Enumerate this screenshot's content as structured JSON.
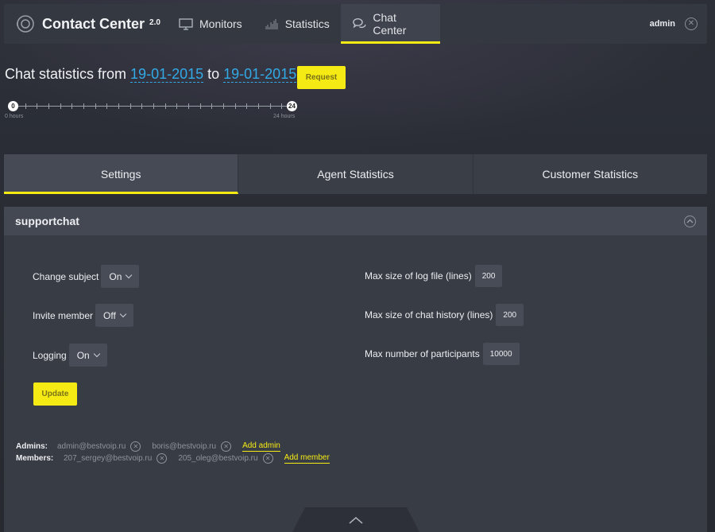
{
  "app": {
    "title": "Contact Center",
    "version": "2.0",
    "logo_icon": "headset-icon"
  },
  "nav": [
    {
      "label": "Monitors",
      "icon": "monitor-icon"
    },
    {
      "label": "Statistics",
      "icon": "bar-chart-icon"
    },
    {
      "label": "Chat Center",
      "icon": "chat-bubbles-icon",
      "active": true
    }
  ],
  "user": {
    "name": "admin"
  },
  "stats": {
    "prefix": "Chat statistics from",
    "date_from": "19-01-2015",
    "connector": "to",
    "date_to": "19-01-2015",
    "request_label": "Request"
  },
  "slider": {
    "start_value": "0",
    "end_value": "24",
    "start_label": "0 hours",
    "end_label": "24 hours"
  },
  "tabs": [
    {
      "label": "Settings",
      "active": true
    },
    {
      "label": "Agent Statistics"
    },
    {
      "label": "Customer Statistics"
    }
  ],
  "panel": {
    "title": "supportchat",
    "left_settings": [
      {
        "label": "Change subject",
        "value": "On"
      },
      {
        "label": "Invite member",
        "value": "Off"
      },
      {
        "label": "Logging",
        "value": "On"
      }
    ],
    "right_settings": [
      {
        "label": "Max size of log file (lines)",
        "value": "200"
      },
      {
        "label": "Max size of chat history (lines)",
        "value": "200"
      },
      {
        "label": "Max number of participants",
        "value": "10000"
      }
    ],
    "update_label": "Update",
    "admins_label": "Admins:",
    "admins": [
      "admin@bestvoip.ru",
      "boris@bestvoip.ru"
    ],
    "add_admin_label": "Add admin",
    "members_label": "Members:",
    "members": [
      "207_sergey@bestvoip.ru",
      "205_oleg@bestvoip.ru"
    ],
    "add_member_label": "Add member"
  },
  "colors": {
    "accent": "#f6ea14",
    "link": "#33a9e6",
    "background": "#2a2d35",
    "panel": "#383c45"
  }
}
